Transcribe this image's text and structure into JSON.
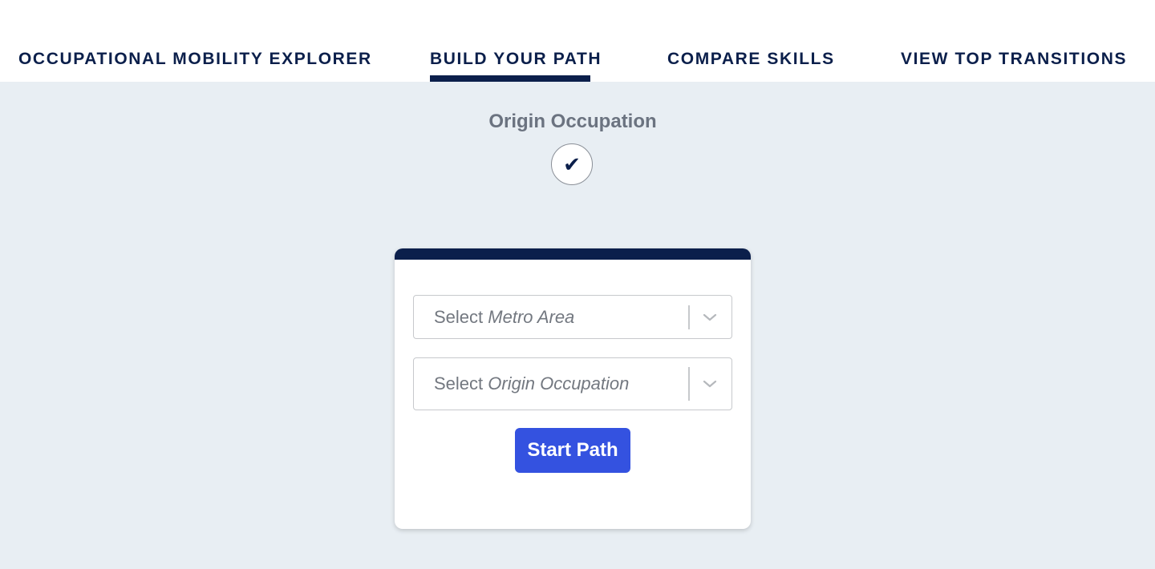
{
  "nav": {
    "tabs": [
      {
        "label": "OCCUPATIONAL MOBILITY EXPLORER",
        "active": false
      },
      {
        "label": "BUILD YOUR PATH",
        "active": true
      },
      {
        "label": "COMPARE SKILLS",
        "active": false
      },
      {
        "label": "VIEW TOP TRANSITIONS",
        "active": false
      }
    ]
  },
  "step": {
    "title": "Origin Occupation",
    "check_glyph": "✔"
  },
  "form": {
    "metro_select": {
      "prefix": "Select",
      "emphasis": "Metro Area"
    },
    "origin_select": {
      "prefix": "Select",
      "emphasis": "Origin Occupation"
    },
    "start_label": "Start Path"
  },
  "colors": {
    "navy": "#0b1f4b",
    "accent_button": "#3452e0",
    "page_bg": "#e8eef3"
  },
  "icons": {
    "step": "checkmark-icon",
    "select_arrow": "chevron-down-icon"
  }
}
